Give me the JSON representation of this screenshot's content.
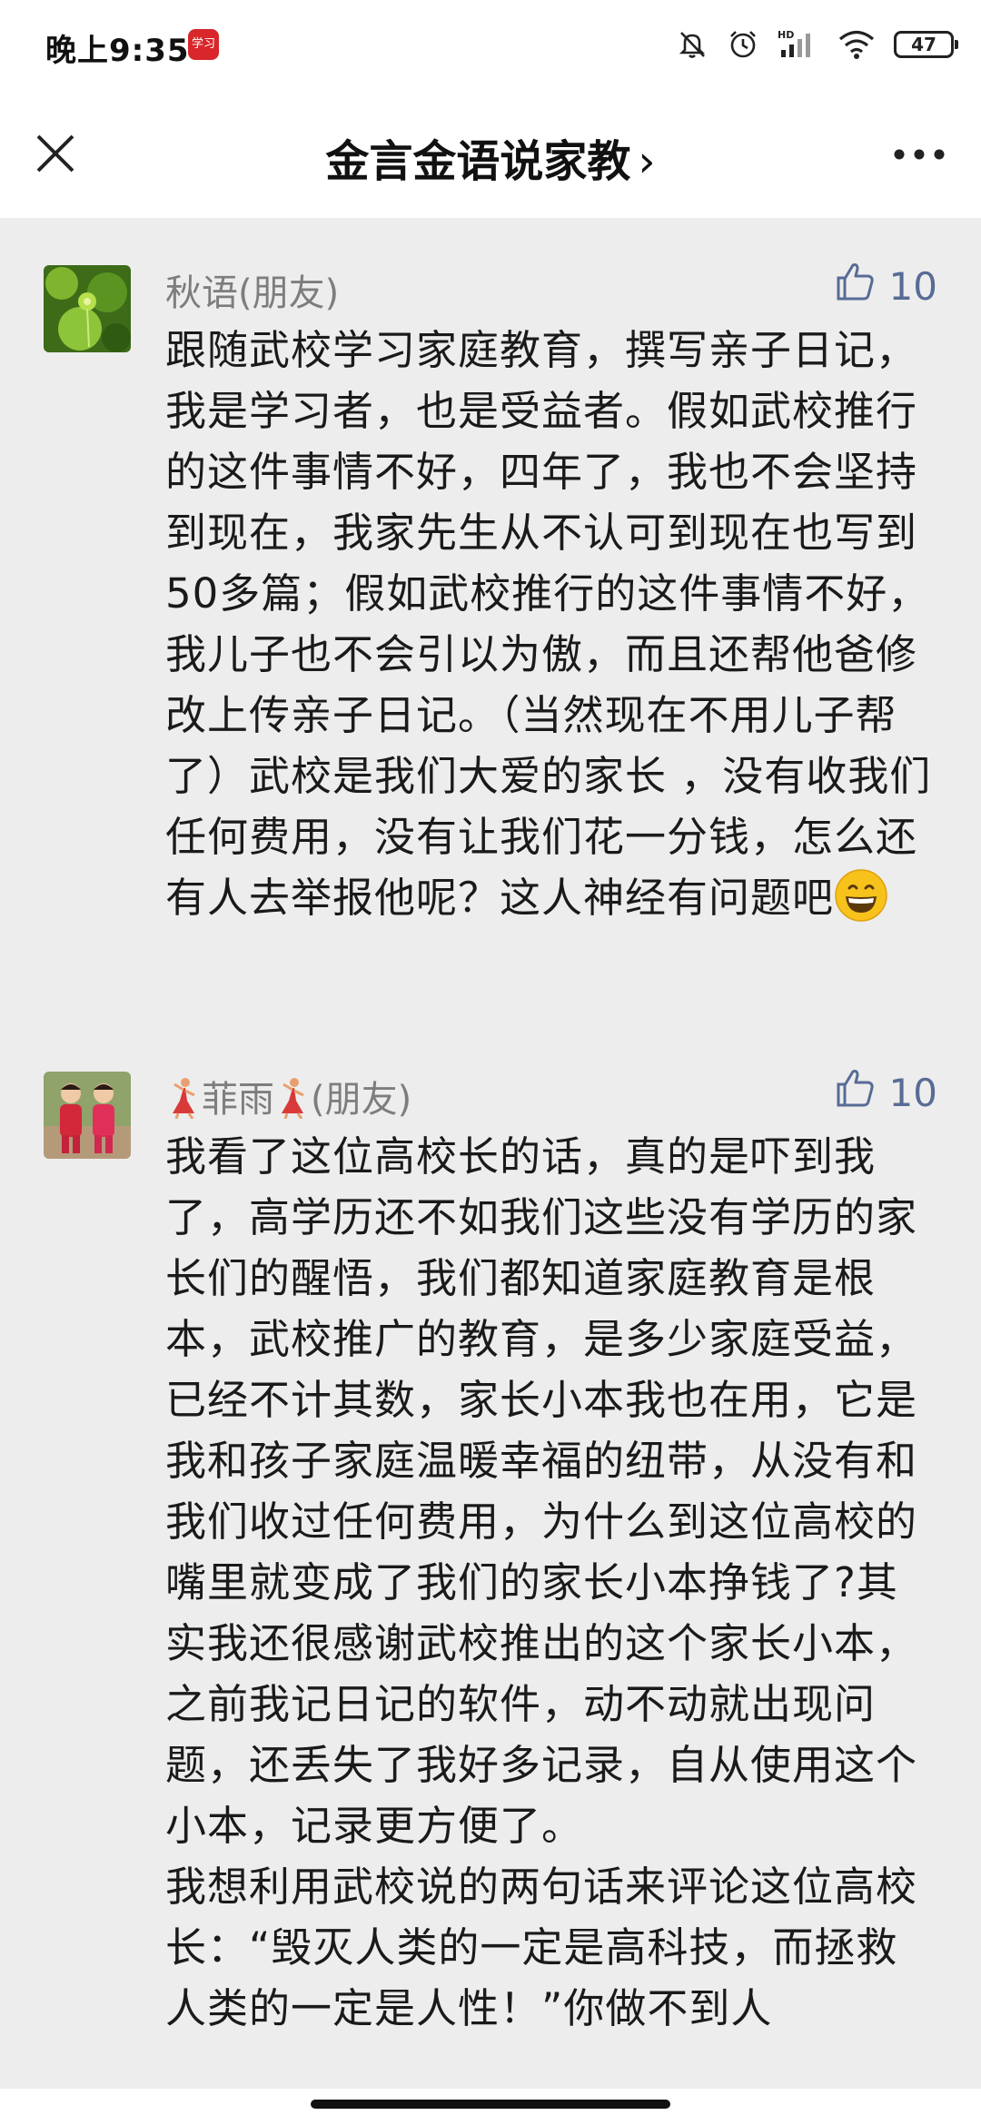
{
  "status_bar": {
    "time": "晚上9:35",
    "app_icon_text": "学习",
    "battery": "47",
    "icons": [
      "mute-icon",
      "alarm-icon",
      "hd-signal-icon",
      "wifi-icon",
      "battery-icon"
    ]
  },
  "nav": {
    "title": "金言金语说家教",
    "chevron": "›",
    "close_icon": "close-icon",
    "more_icon": "more-icon"
  },
  "comments": [
    {
      "name": "秋语(朋友)",
      "likes": "10",
      "text": "跟随武校学习家庭教育，撰写亲子日记，我是学习者，也是受益者。假如武校推行的这件事情不好，四年了，我也不会坚持到现在，我家先生从不认可到现在也写到50多篇；假如武校推行的这件事情不好，我儿子也不会引以为傲，而且还帮他爸修改上传亲子日记。（当然现在不用儿子帮了）武校是我们大爱的家长 ，没有收我们任何费用，没有让我们花一分钱，怎么还有人去举报他呢？这人神经有问题吧"
    },
    {
      "name": "菲雨",
      "name_suffix": "(朋友)",
      "likes": "10",
      "text": "我看了这位高校长的话，真的是吓到我了，高学历还不如我们这些没有学历的家长们的醒悟，我们都知道家庭教育是根本，武校推广的教育，是多少家庭受益，已经不计其数，家长小本我也在用，它是我和孩子家庭温暖幸福的纽带，从没有和我们收过任何费用，为什么到这位高校的嘴里就变成了我们的家长小本挣钱了?其实我还很感谢武校推出的这个家长小本，之前我记日记的软件，动不动就出现问题，还丢失了我好多记录，自从使用这个小本，记录更方便了。",
      "text2": "我想利用武校说的两句话来评论这位高校长：“毁灭人类的一定是高科技，而拯救人类的一定是人性！”你做不到人"
    }
  ],
  "colors": {
    "like_blue": "#576b95",
    "name_gray": "#7d7d7d",
    "background": "#ededed"
  }
}
